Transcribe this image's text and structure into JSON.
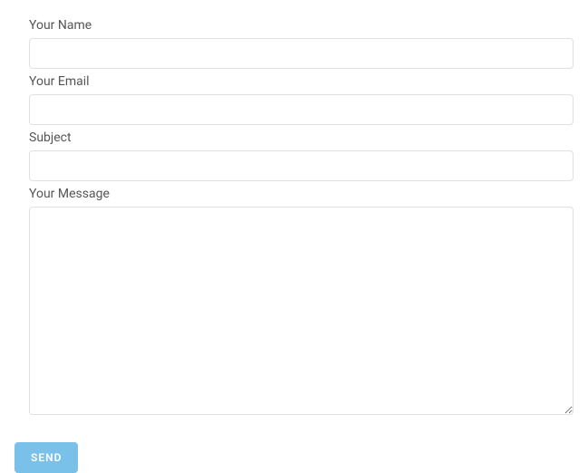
{
  "form": {
    "name": {
      "label": "Your Name",
      "value": ""
    },
    "email": {
      "label": "Your Email",
      "value": ""
    },
    "subject": {
      "label": "Subject",
      "value": ""
    },
    "message": {
      "label": "Your Message",
      "value": ""
    },
    "submit_label": "SEND"
  }
}
